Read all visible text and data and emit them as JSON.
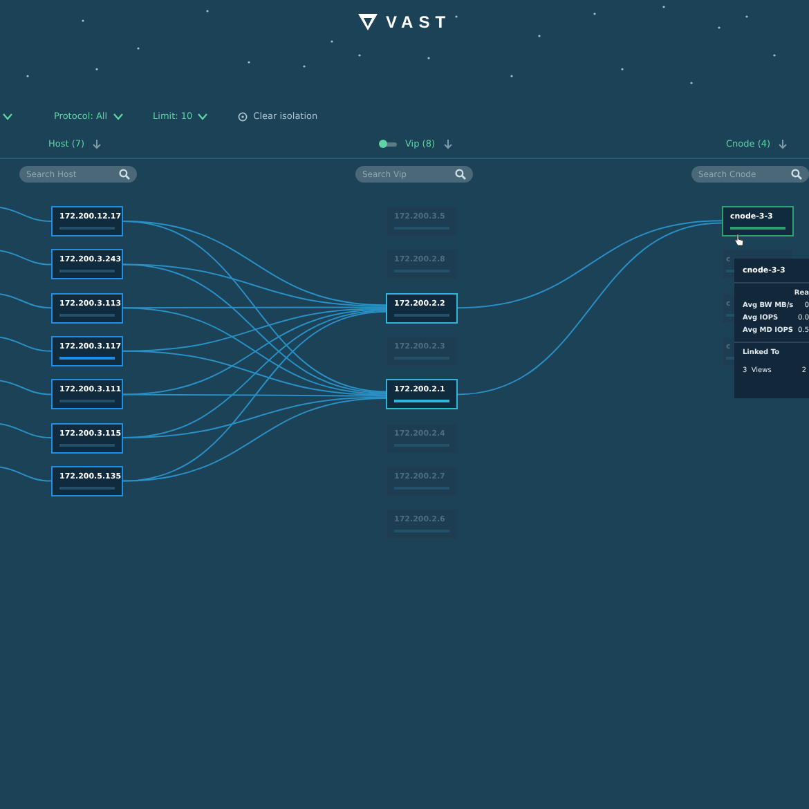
{
  "logo": {
    "text": "VAST"
  },
  "filters": [
    {
      "label": "Protocol: All"
    },
    {
      "label": "Limit: 10"
    }
  ],
  "clear_isolation": {
    "label": "Clear isolation"
  },
  "columns": [
    {
      "kind": "host",
      "title": "Host (7)",
      "search": {
        "placeholder": "Search Host"
      },
      "nodes": [
        {
          "label": "172.200.12.17",
          "active": true,
          "highlighted": false
        },
        {
          "label": "172.200.3.243",
          "active": true,
          "highlighted": false
        },
        {
          "label": "172.200.3.113",
          "active": true,
          "highlighted": false
        },
        {
          "label": "172.200.3.117",
          "active": true,
          "highlighted": true
        },
        {
          "label": "172.200.3.111",
          "active": true,
          "highlighted": false
        },
        {
          "label": "172.200.3.115",
          "active": true,
          "highlighted": false
        },
        {
          "label": "172.200.5.135",
          "active": true,
          "highlighted": false
        }
      ]
    },
    {
      "kind": "vip",
      "title": "Vip (8)",
      "toggle": {
        "on": true
      },
      "search": {
        "placeholder": "Search Vip"
      },
      "nodes": [
        {
          "label": "172.200.3.5",
          "active": false,
          "highlighted": false
        },
        {
          "label": "172.200.2.8",
          "active": false,
          "highlighted": false
        },
        {
          "label": "172.200.2.2",
          "active": true,
          "highlighted": false
        },
        {
          "label": "172.200.2.3",
          "active": false,
          "highlighted": false
        },
        {
          "label": "172.200.2.1",
          "active": true,
          "highlighted": true
        },
        {
          "label": "172.200.2.4",
          "active": false,
          "highlighted": false
        },
        {
          "label": "172.200.2.7",
          "active": false,
          "highlighted": false
        },
        {
          "label": "172.200.2.6",
          "active": false,
          "highlighted": false
        }
      ]
    },
    {
      "kind": "cnode",
      "title": "Cnode (4)",
      "search": {
        "placeholder": "Search Cnode"
      },
      "nodes": [
        {
          "label": "cnode-3-3",
          "active": true,
          "highlighted": true
        },
        {
          "label": "c",
          "active": false,
          "highlighted": false
        },
        {
          "label": "c",
          "active": false,
          "highlighted": false
        },
        {
          "label": "c",
          "active": false,
          "highlighted": false
        }
      ]
    }
  ],
  "tooltip": {
    "title": "cnode-3-3",
    "column": "Rea",
    "rows": [
      {
        "label": "Avg BW MB/s",
        "value": "0"
      },
      {
        "label": "Avg IOPS",
        "value": "0.0"
      },
      {
        "label": "Avg MD IOPS",
        "value": "0.5"
      }
    ],
    "linked_title": "Linked To",
    "linked": [
      "3  Views",
      "2"
    ]
  }
}
